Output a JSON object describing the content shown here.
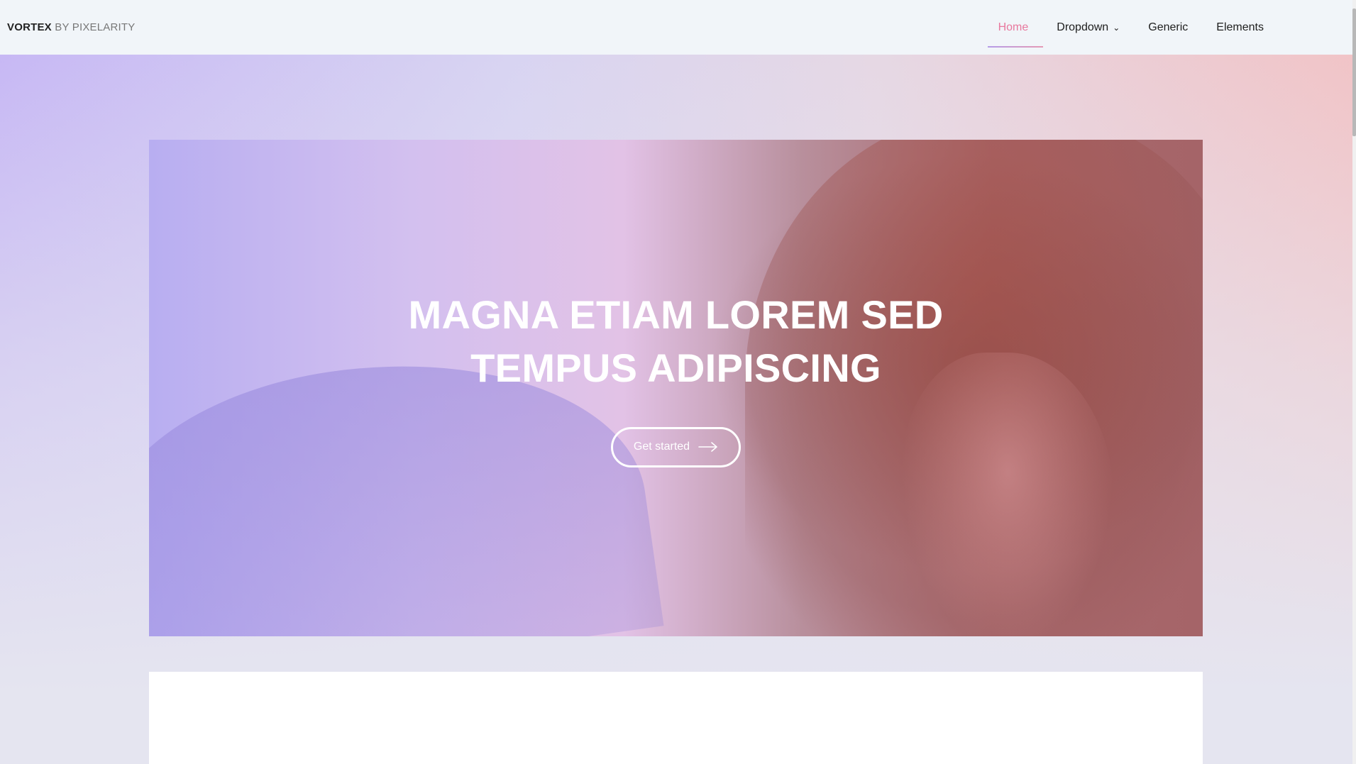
{
  "brand": {
    "name": "VORTEX",
    "by": "BY PIXELARITY"
  },
  "nav": {
    "items": [
      {
        "label": "Home",
        "active": true
      },
      {
        "label": "Dropdown",
        "caret": "chevron-down-icon"
      },
      {
        "label": "Generic"
      },
      {
        "label": "Elements"
      }
    ],
    "caret_glyph": "⌄"
  },
  "hero": {
    "title": "MAGNA ETIAM LOREM SED TEMPUS ADIPISCING",
    "cta_label": "Get started",
    "cta_icon": "arrow-right-icon"
  },
  "colors": {
    "accent": "#e8789e",
    "header_bg": "#f1f5f9",
    "gradient_start": "#c7b8f4",
    "gradient_end": "#f1c4c7"
  }
}
